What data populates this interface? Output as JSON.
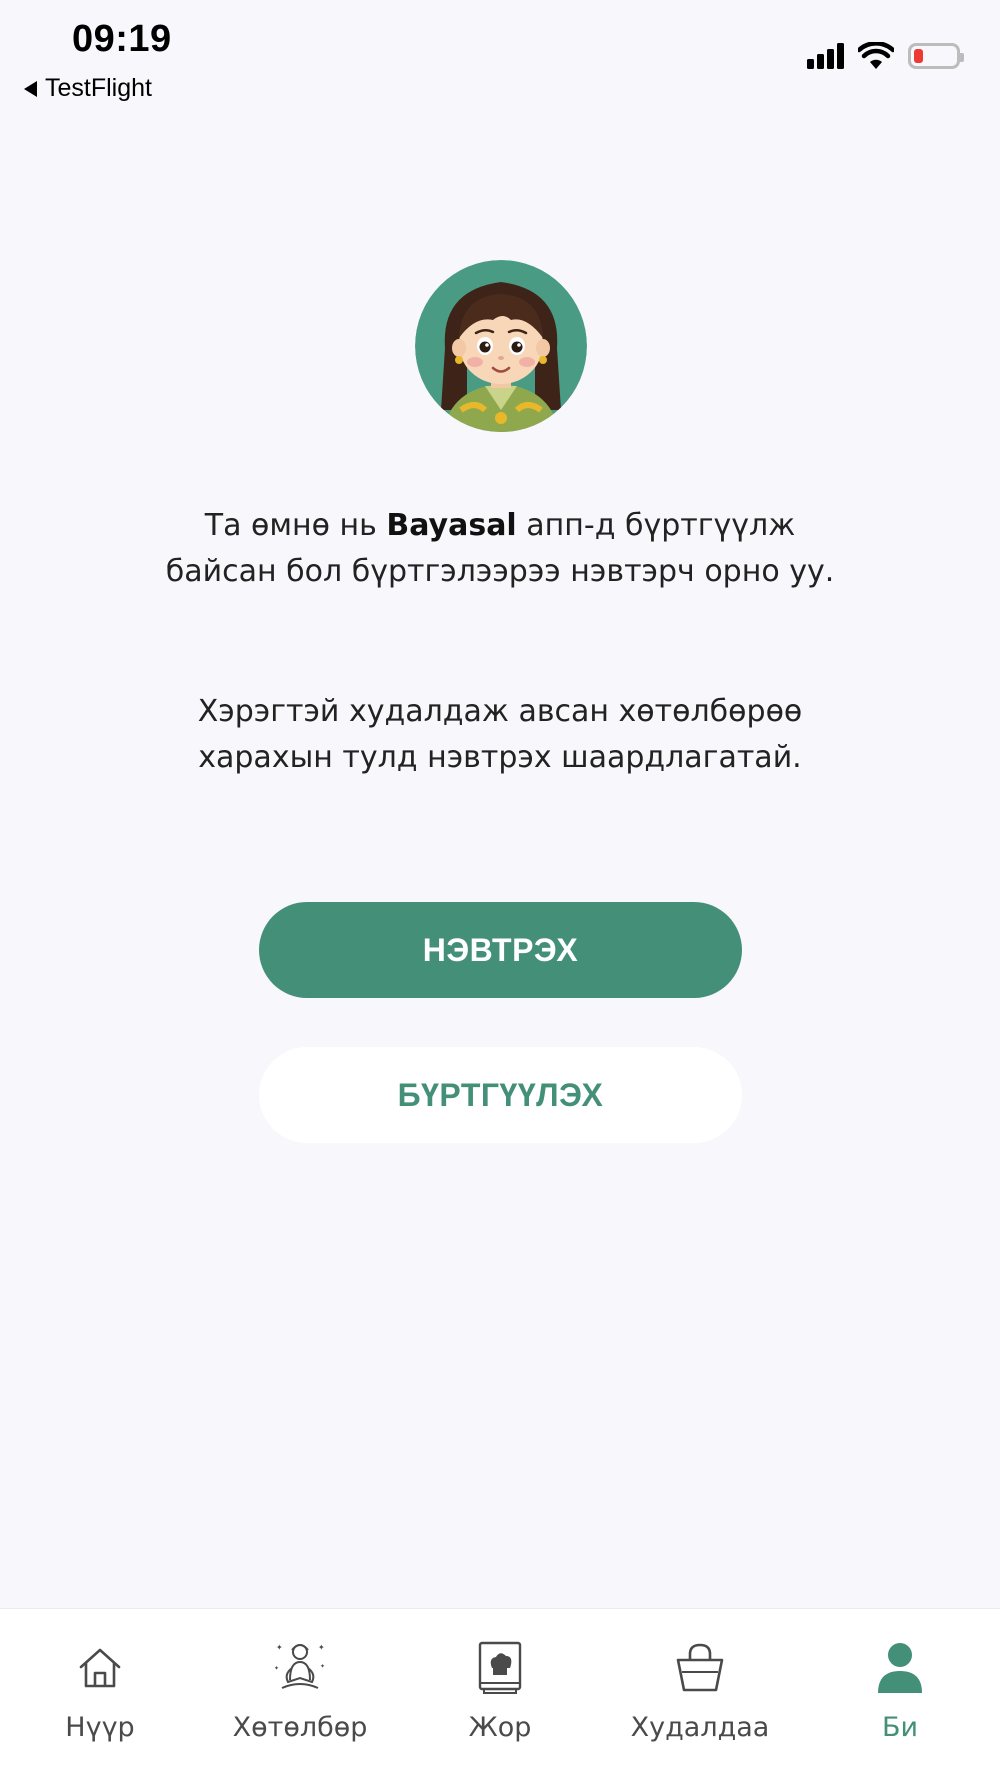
{
  "status_bar": {
    "time": "09:19",
    "back_app": "TestFlight",
    "battery_color": "#EB3B32"
  },
  "avatar": {
    "icon": "girl-avatar-icon",
    "background": "#4A9B84"
  },
  "message": {
    "line1_prefix": "Та өмнө нь ",
    "brand": "Bayasal",
    "line1_suffix": " апп-д бүртгүүлж байсан бол бүртгэлээрээ нэвтэрч орно уу.",
    "line2": "Хэрэгтэй худалдаж авсан хөтөлбөрөө харахын тулд нэвтрэх шаардлагатай."
  },
  "buttons": {
    "login": "НЭВТРЭХ",
    "register": "БҮРТГҮҮЛЭХ"
  },
  "nav": {
    "items": [
      {
        "label": "Нүүр",
        "icon": "home-icon"
      },
      {
        "label": "Хөтөлбөр",
        "icon": "yoga-icon"
      },
      {
        "label": "Жор",
        "icon": "recipe-book-icon"
      },
      {
        "label": "Худалдаа",
        "icon": "shopping-bag-icon"
      },
      {
        "label": "Би",
        "icon": "profile-icon"
      }
    ],
    "active_index": 4
  },
  "colors": {
    "accent": "#448F78",
    "page_bg": "#F7F7FC",
    "nav_inactive": "#4A4A4A"
  }
}
